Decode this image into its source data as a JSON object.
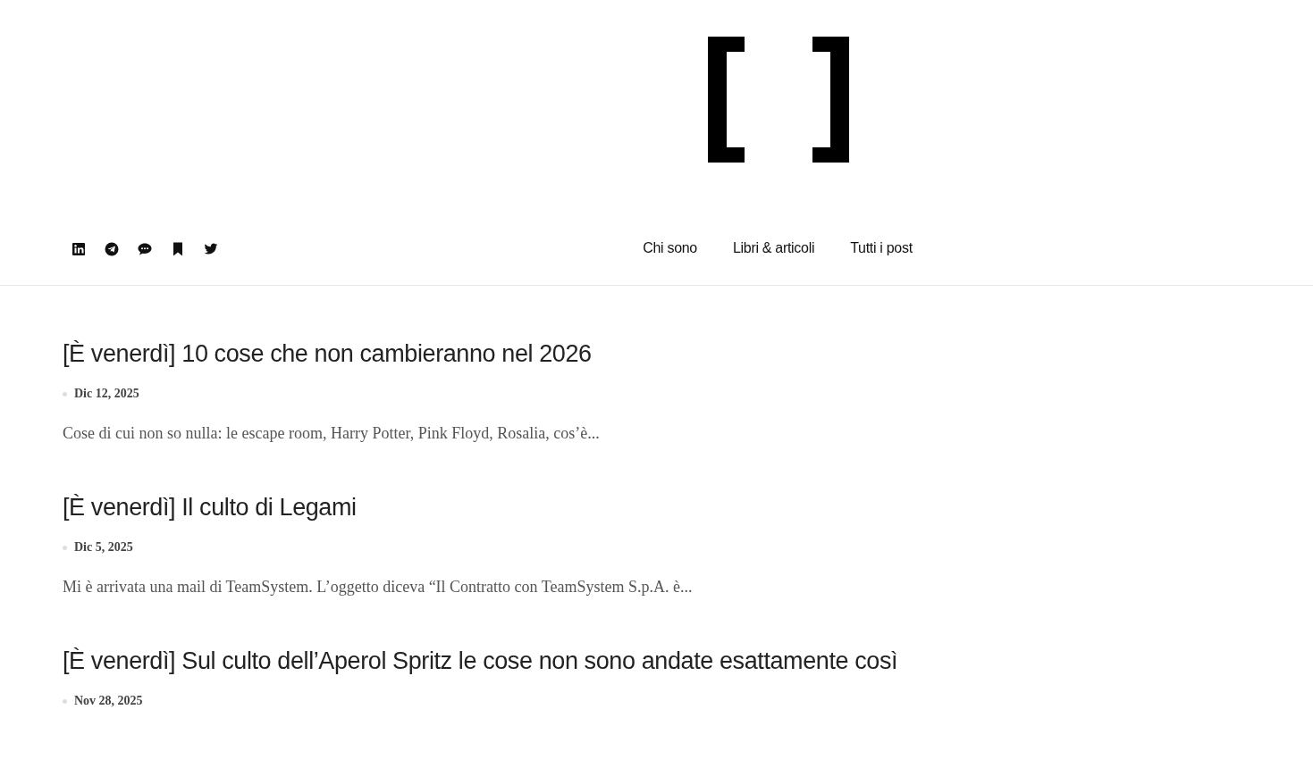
{
  "nav": [
    {
      "label": "Chi sono"
    },
    {
      "label": "Libri & articoli"
    },
    {
      "label": "Tutti i post"
    }
  ],
  "social": [
    {
      "kind": "tile"
    },
    {
      "kind": "plane"
    },
    {
      "kind": "chat"
    },
    {
      "kind": "bookmark"
    },
    {
      "kind": "bird"
    }
  ],
  "posts": [
    {
      "title": "[È venerdì] 10 cose che non cambieranno nel 2026",
      "date": "Dic 12, 2025",
      "excerpt": "Cose di cui non so nulla: le escape room, Harry Potter, Pink Floyd, Rosalia, cos’è..."
    },
    {
      "title": "[È venerdì] Il culto di Legami",
      "date": "Dic 5, 2025",
      "excerpt": "Mi è arrivata una mail di TeamSystem. L’oggetto diceva “Il Contratto con TeamSystem S.p.A. è..."
    },
    {
      "title": "[È venerdì] Sul culto dell’Aperol Spritz le cose non sono andate esattamente così",
      "date": "Nov 28, 2025"
    }
  ]
}
